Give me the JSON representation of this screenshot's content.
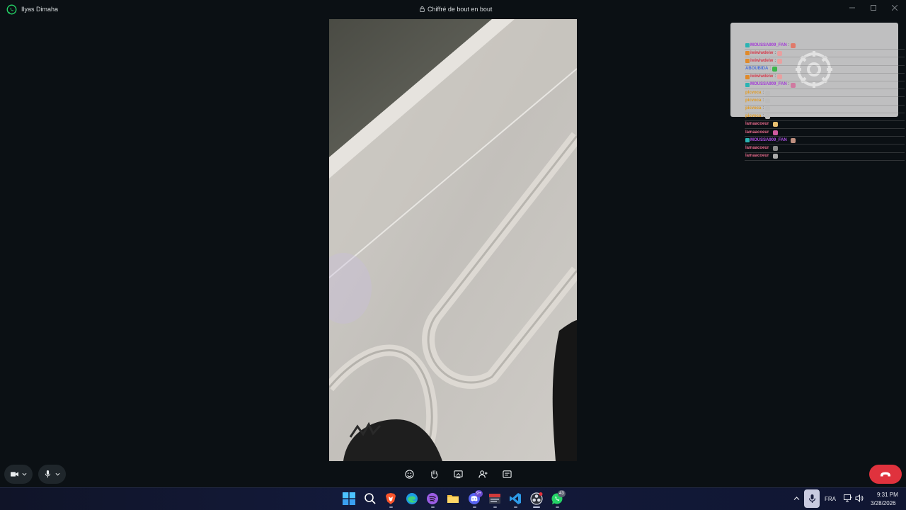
{
  "titlebar": {
    "contact_name": "Ilyas Dimaha",
    "encryption_label": "Chiffré de bout en bout"
  },
  "chat": {
    "messages": [
      {
        "user": "MOUSSA909_FAN",
        "color": "#a239d6",
        "badge": "#2bb3b3"
      },
      {
        "user": "iwiwiwdeiw",
        "color": "#d63b4c",
        "badge": "#e08a2a"
      },
      {
        "user": "iwiwiwdeiw",
        "color": "#d63b4c",
        "badge": "#e08a2a"
      },
      {
        "user": "ABOUBIDA",
        "color": "#4a6fd8",
        "badge": ""
      },
      {
        "user": "iwiwiwdeiw",
        "color": "#d63b4c",
        "badge": "#e08a2a"
      },
      {
        "user": "MOUSSA909_FAN",
        "color": "#a239d6",
        "badge": "#2bb3b3"
      },
      {
        "user": "picvoca",
        "color": "#e29a1f",
        "badge": ""
      },
      {
        "user": "picvoca",
        "color": "#e29a1f",
        "badge": ""
      },
      {
        "user": "picvoca",
        "color": "#e29a1f",
        "badge": ""
      },
      {
        "user": "picvoca",
        "color": "#e29a1f",
        "badge": ""
      },
      {
        "user": "lamaacoeur",
        "color": "#e4688a",
        "badge": ""
      },
      {
        "user": "lamaacoeur",
        "color": "#e4688a",
        "badge": ""
      },
      {
        "user": "MOUSSA909_FAN",
        "color": "#b050e8",
        "badge": "#2bb3b3"
      },
      {
        "user": "lamaacoeur",
        "color": "#e4688a",
        "badge": ""
      },
      {
        "user": "lamaacoeur",
        "color": "#e4688a",
        "badge": ""
      }
    ]
  },
  "taskbar": {
    "discord_badge": "9+",
    "whatsapp_badge": "43",
    "language": "FRA",
    "time": "9:31 PM",
    "date": "3/28/2026"
  },
  "colors": {
    "accent": "#25d366",
    "end_call": "#e0323d",
    "background": "#0b1014"
  }
}
